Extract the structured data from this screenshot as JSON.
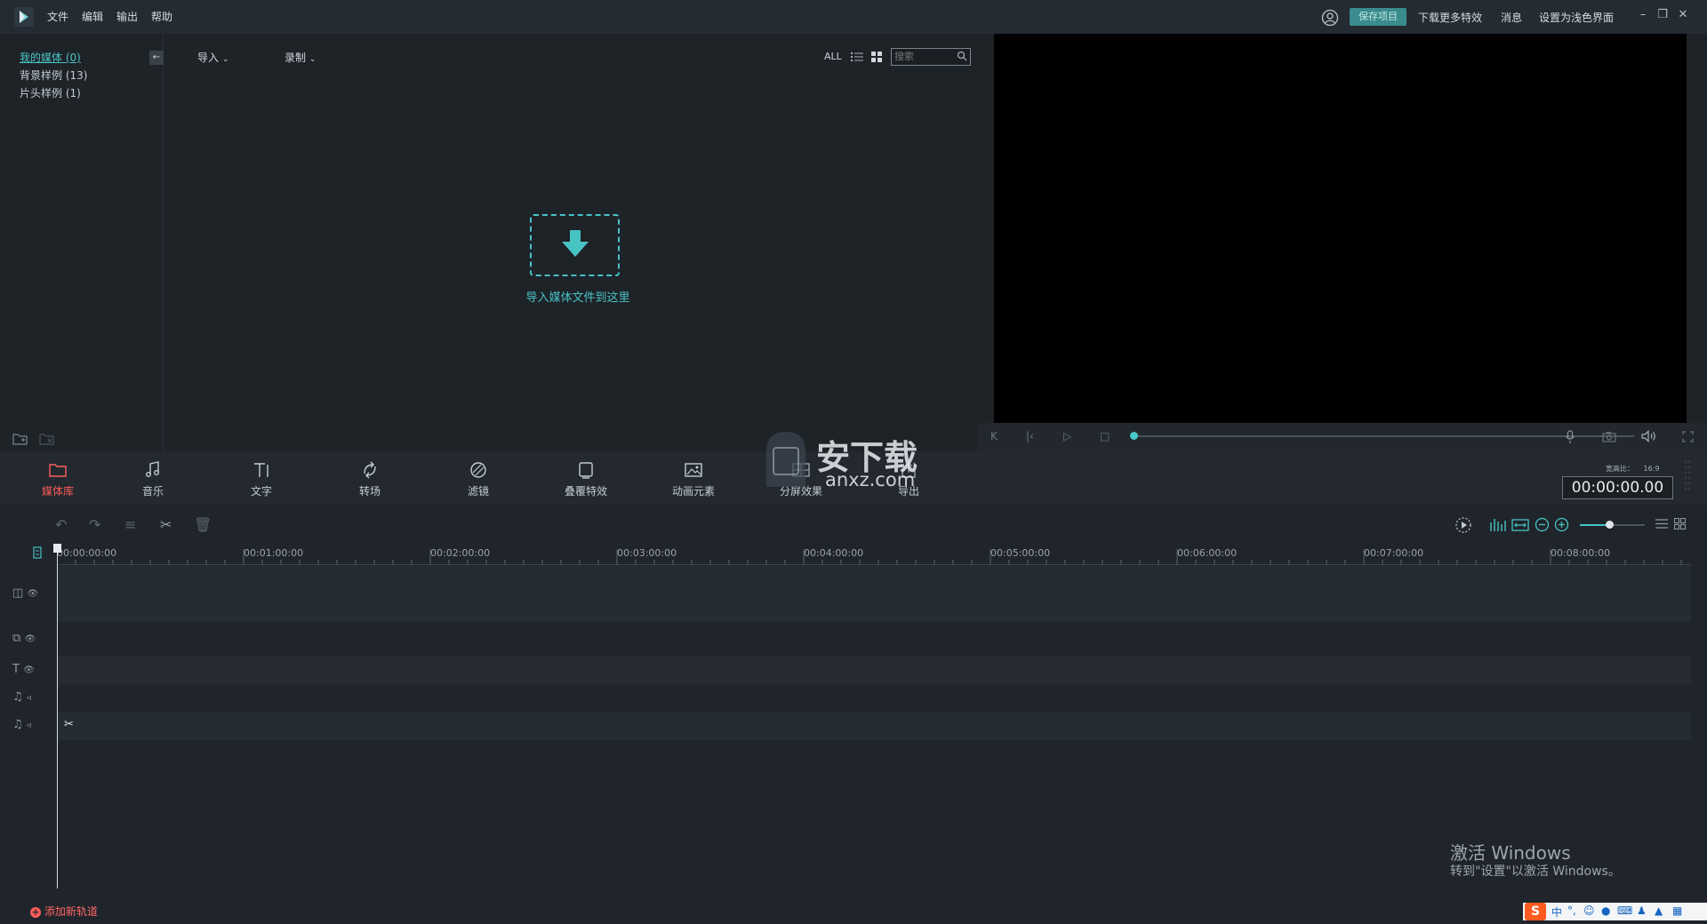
{
  "colors": {
    "accent": "#49c5c5",
    "active_module": "#ff5c5c",
    "bg": "#1e2328"
  },
  "menu": [
    "文件",
    "编辑",
    "输出",
    "帮助"
  ],
  "titlebar_right": {
    "save_label": "保存项目",
    "download_effects": "下载更多特效",
    "messages": "消息",
    "theme_toggle": "设置为浅色界面"
  },
  "tree": {
    "items": [
      {
        "label": "我的媒体 (0)"
      },
      {
        "label": "背景样例 (13)"
      },
      {
        "label": "片头样例 (1)"
      }
    ]
  },
  "media": {
    "import_dropdown": "导入",
    "record_dropdown": "录制",
    "filter_all": "ALL",
    "search_placeholder": "搜索",
    "drop_hint": "导入媒体文件到这里"
  },
  "modules": [
    {
      "label": "媒体库",
      "icon": "folder-icon"
    },
    {
      "label": "音乐",
      "icon": "music-icon"
    },
    {
      "label": "文字",
      "icon": "text-icon"
    },
    {
      "label": "转场",
      "icon": "transition-icon"
    },
    {
      "label": "滤镜",
      "icon": "filter-icon"
    },
    {
      "label": "叠覆特效",
      "icon": "overlay-icon"
    },
    {
      "label": "动画元素",
      "icon": "image-icon"
    },
    {
      "label": "分屏效果",
      "icon": "split-icon"
    },
    {
      "label": "导出",
      "icon": "export-icon"
    }
  ],
  "preview": {
    "aspect_label": "宽高比：",
    "aspect_value": "16:9",
    "timecode": "00:00:00.00"
  },
  "timeline": {
    "ruler": [
      "00:00:00:00",
      "00:01:00:00",
      "00:02:00:00",
      "00:03:00:00",
      "00:04:00:00",
      "00:05:00:00",
      "00:06:00:00",
      "00:07:00:00",
      "00:08:00:00"
    ],
    "add_track": "添加新轨道"
  },
  "watermark": {
    "line1": "激活 Windows",
    "line2": "转到\"设置\"以激活 Windows。",
    "site": "安下载",
    "site_url": "anxz.com"
  }
}
